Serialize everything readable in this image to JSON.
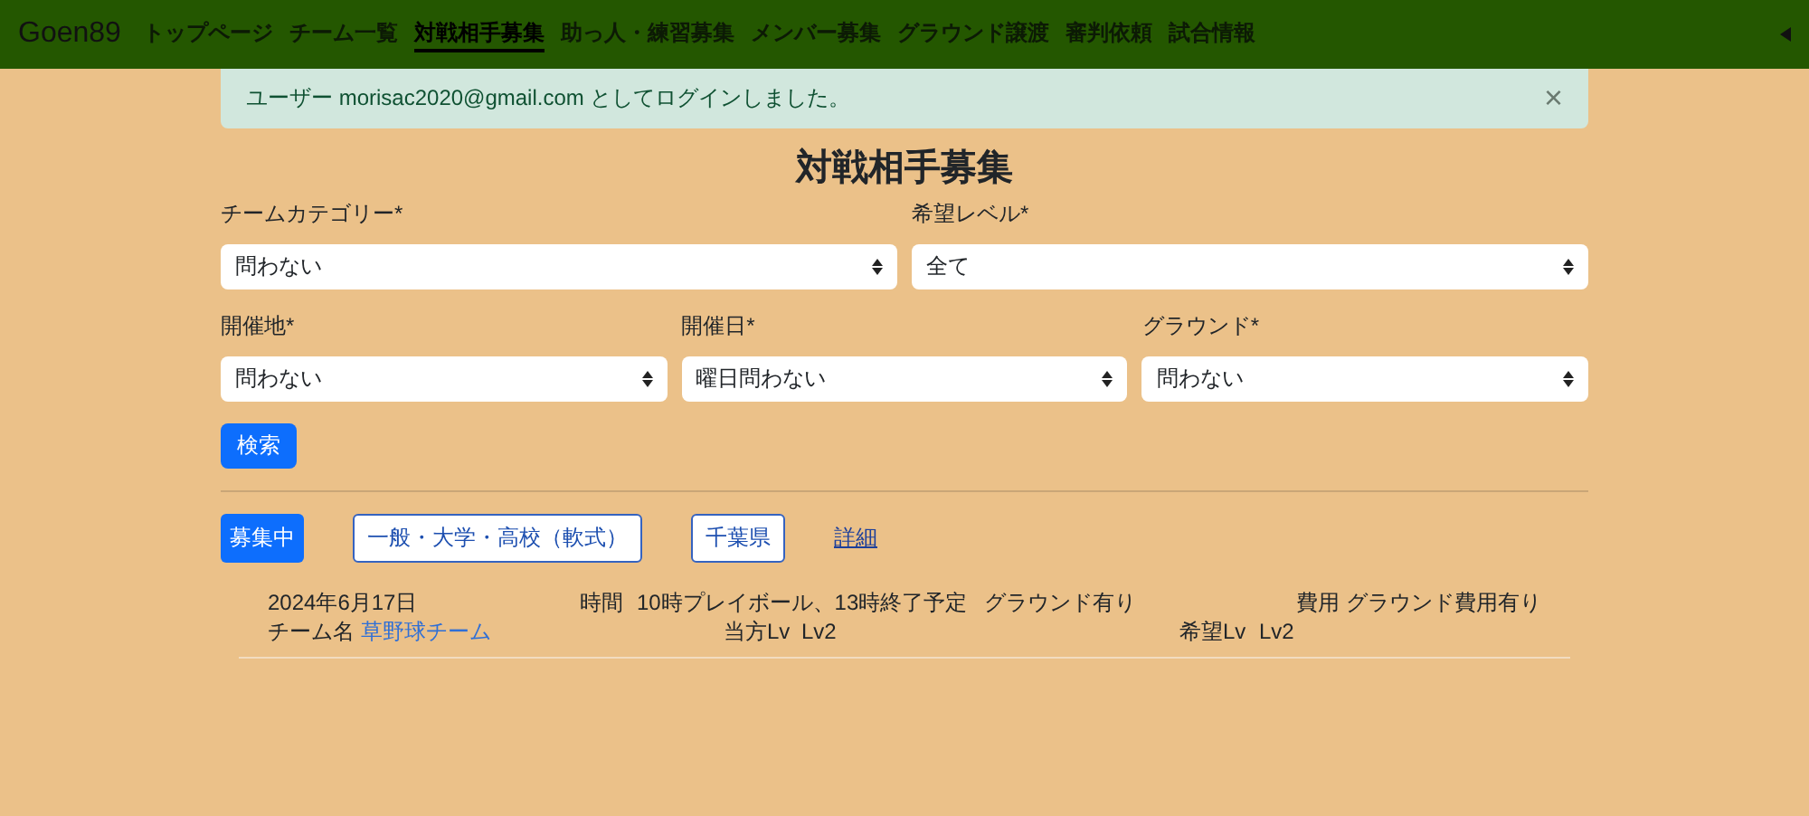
{
  "navbar": {
    "brand": "Goen89",
    "items": [
      {
        "label": "トップページ",
        "selected": false
      },
      {
        "label": "チーム一覧",
        "selected": false
      },
      {
        "label": "対戦相手募集",
        "selected": true
      },
      {
        "label": "助っ人・練習募集",
        "selected": false
      },
      {
        "label": "メンバー募集",
        "selected": false
      },
      {
        "label": "グラウンド譲渡",
        "selected": false
      },
      {
        "label": "審判依頼",
        "selected": false
      },
      {
        "label": "試合情報",
        "selected": false
      }
    ]
  },
  "alert": {
    "message": "ユーザー morisac2020@gmail.com としてログインしました。",
    "close": "×"
  },
  "title": "対戦相手募集",
  "form": {
    "rows": [
      [
        {
          "label": "チームカテゴリー*",
          "value": "問わない"
        },
        {
          "label": "希望レベル*",
          "value": "全て"
        }
      ],
      [
        {
          "label": "開催地*",
          "value": "問わない"
        },
        {
          "label": "開催日*",
          "value": "曜日問わない"
        },
        {
          "label": "グラウンド*",
          "value": "問わない"
        }
      ]
    ],
    "submit": "検索"
  },
  "listings": [
    {
      "status": "募集中",
      "category": "一般・大学・高校（軟式）",
      "prefecture": "千葉県",
      "detail_link": "詳細",
      "date": "2024年6月17日",
      "time_label": "時間",
      "time": "10時プレイボール、13時終了予定",
      "ground": "グラウンド有り",
      "fee": "費用 グラウンド費用有り",
      "team_label": "チーム名",
      "team": "草野球チーム",
      "own_level_label": "当方Lv",
      "own_level": "Lv2",
      "wanted_level_label": "希望Lv",
      "wanted_level": "Lv2"
    }
  ]
}
